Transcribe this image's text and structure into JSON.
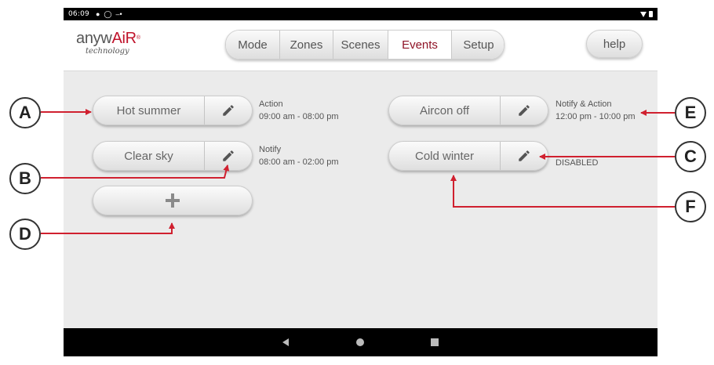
{
  "status_bar": {
    "time": "06:09",
    "icons": [
      "notification-icon",
      "alarm-icon",
      "cast-icon"
    ],
    "right_icons": [
      "wifi-icon",
      "battery-icon"
    ]
  },
  "logo": {
    "brand_pre": "anyw",
    "brand_accent": "AiR",
    "brand_mark": "®",
    "subtitle": "technology"
  },
  "tabs": [
    {
      "label": "Mode",
      "active": false
    },
    {
      "label": "Zones",
      "active": false
    },
    {
      "label": "Scenes",
      "active": false
    },
    {
      "label": "Events",
      "active": true
    },
    {
      "label": "Setup",
      "active": false
    }
  ],
  "help_label": "help",
  "events": [
    {
      "name": "Hot summer",
      "type": "Action",
      "time": "09:00 am - 08:00 pm"
    },
    {
      "name": "Clear sky",
      "type": "Notify",
      "time": "08:00 am - 02:00 pm"
    },
    {
      "name": "Aircon off",
      "type": "Notify & Action",
      "time": "12:00 pm - 10:00 pm"
    },
    {
      "name": "Cold winter",
      "type": "DISABLED",
      "time": ""
    }
  ],
  "callouts": [
    "A",
    "B",
    "C",
    "D",
    "E",
    "F"
  ],
  "nav_icons": [
    "back-icon",
    "home-icon",
    "recents-icon"
  ],
  "colors": {
    "accent_red": "#c0132b",
    "active_tab_text": "#8f1326",
    "content_bg": "#ebebeb",
    "arrow_red": "#d0202f"
  }
}
